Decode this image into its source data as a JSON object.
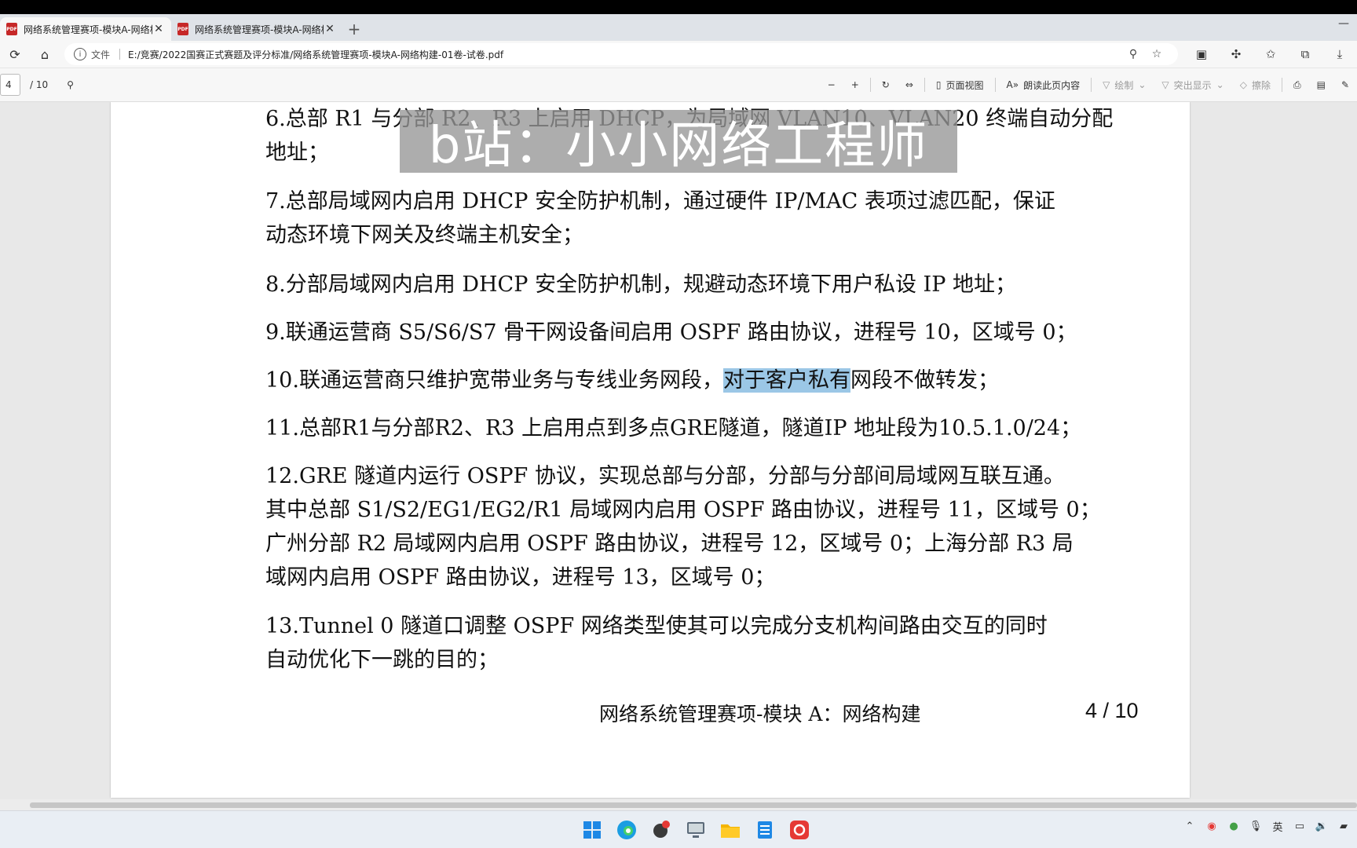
{
  "browser": {
    "tabs": [
      {
        "title": "网络系统管理赛项-模块A-网络构",
        "active": true
      },
      {
        "title": "网络系统管理赛项-模块A-网络构",
        "active": false
      }
    ],
    "new_tab": "+",
    "address": {
      "scheme": "文件",
      "url": "E:/竞赛/2022国赛正式赛题及评分标准/网络系统管理赛项-模块A-网络构建-01卷-试卷.pdf"
    }
  },
  "pdf_toolbar": {
    "page_current": "4",
    "page_total": "/ 10",
    "page_view": "页面视图",
    "read_aloud": "朗读此页内容",
    "draw": "绘制",
    "highlight": "突出显示",
    "erase": "擦除"
  },
  "document": {
    "p6": [
      "6.总部 R1 与分部 R2、R3 上启用 DHCP，为局域网 VLAN10、VLAN20 终端自动分配",
      "地址；"
    ],
    "p7": [
      "7.总部局域网内启用 DHCP 安全防护机制，通过硬件 IP/MAC 表项过滤匹配，保证",
      "动态环境下网关及终端主机安全；"
    ],
    "p8": "8.分部局域网内启用 DHCP 安全防护机制，规避动态环境下用户私设 IP 地址；",
    "p9": "9.联通运营商 S5/S6/S7 骨干网设备间启用 OSPF 路由协议，进程号 10，区域号 0；",
    "p10": {
      "before": "10.联通运营商只维护宽带业务与专线业务网段，",
      "highlight": "对于客户私有",
      "after": "网段不做转发；"
    },
    "p11": "11.总部R1与分部R2、R3 上启用点到多点GRE隧道，隧道IP 地址段为10.5.1.0/24；",
    "p12": [
      "12.GRE 隧道内运行 OSPF 协议，实现总部与分部，分部与分部间局域网互联互通。",
      "其中总部 S1/S2/EG1/EG2/R1 局域网内启用 OSPF 路由协议，进程号 11，区域号 0；",
      "广州分部 R2 局域网内启用 OSPF 路由协议，进程号 12，区域号 0；上海分部 R3 局",
      "域网内启用 OSPF 路由协议，进程号 13，区域号 0；"
    ],
    "p13": [
      "13.Tunnel 0 隧道口调整 OSPF 网络类型使其可以完成分支机构间路由交互的同时",
      "自动优化下一跳的目的；"
    ],
    "footer_title": "网络系统管理赛项-模块 A：网络构建",
    "footer_page": "4 / 10"
  },
  "watermark": "b站：小小网络工程师",
  "taskbar": {
    "tray_lang": "英"
  }
}
